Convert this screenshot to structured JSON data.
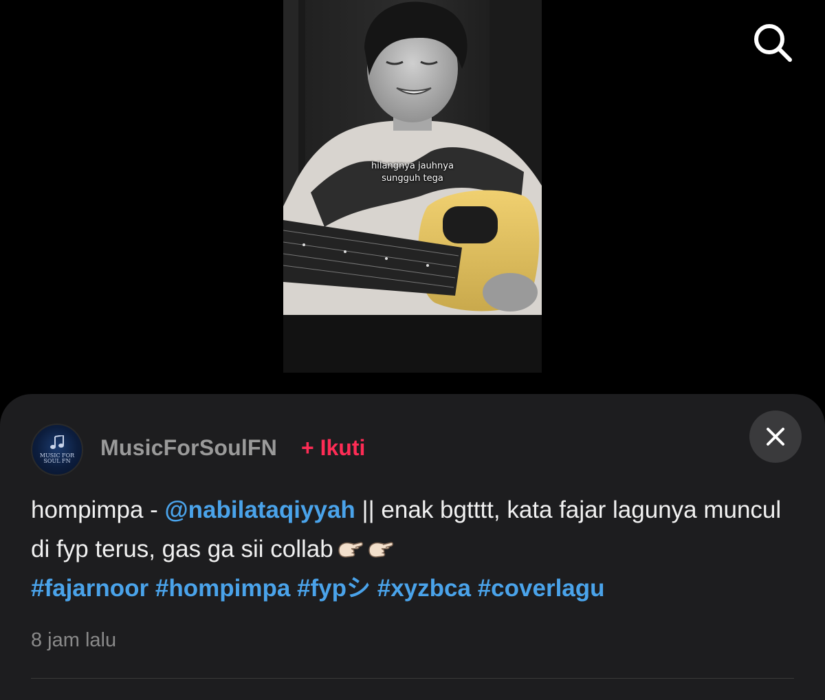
{
  "video": {
    "caption_line1": "hilangnya jauhnya",
    "caption_line2": "sungguh tega"
  },
  "post": {
    "avatar_text_line1": "MUSIC FOR",
    "avatar_text_line2": "SOUL FN",
    "username": "MusicForSoulFN",
    "follow_label": "+ Ikuti",
    "description_prefix": "hompimpa - ",
    "mention": "@nabilataqiyyah",
    "description_text": " || enak bgtttt, kata fajar lagunya muncul di fyp terus, gas ga sii collab",
    "hashtags": [
      "#fajarnoor",
      "#hompimpa",
      "#fypシ",
      "#xyzbca",
      "#coverlagu"
    ],
    "timestamp": "8 jam lalu"
  },
  "icons": {
    "search": "search-icon",
    "close": "close-icon",
    "emoji": "pinching-hand-emoji"
  },
  "colors": {
    "background": "#000000",
    "sheet": "#1d1d1f",
    "username": "#9a9a9a",
    "follow": "#fe2c55",
    "link": "#4aa3ea",
    "timestamp": "#8a8a8a"
  }
}
